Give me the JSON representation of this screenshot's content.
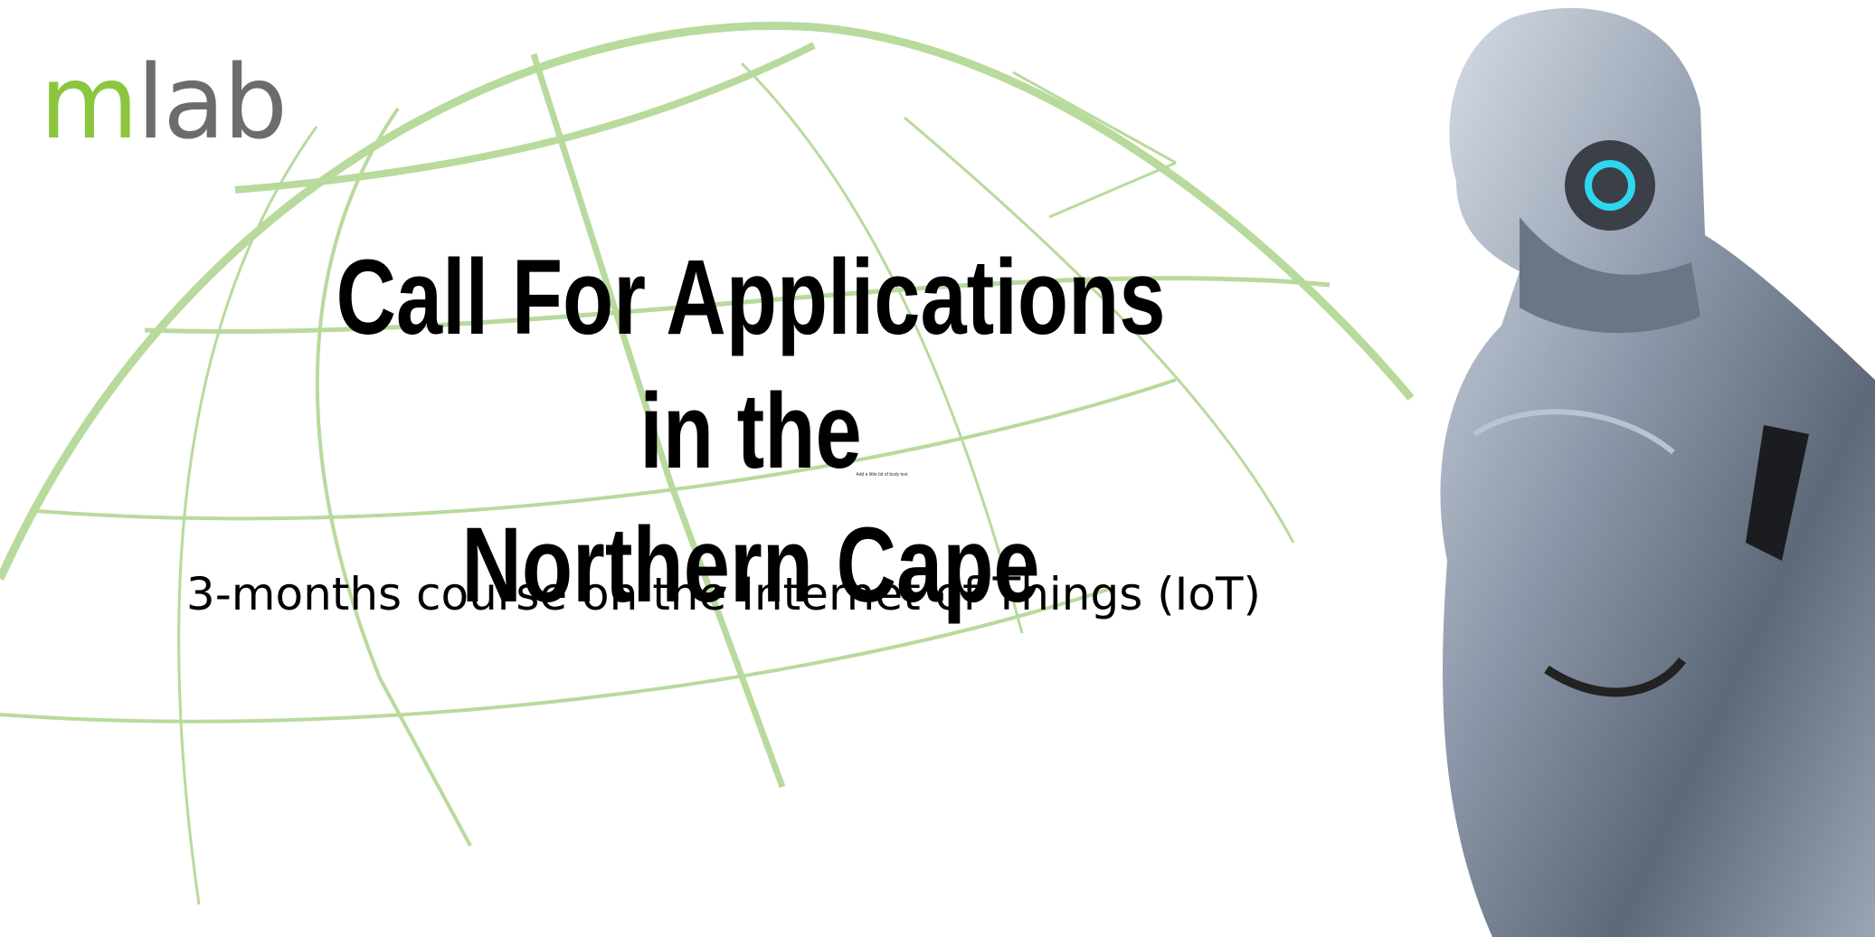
{
  "logo": {
    "text_m": "m",
    "text_lab": "lab",
    "color_m": "#8cc63f",
    "color_lab": "#6b6d6c"
  },
  "title_line1": "Call For Applications in the",
  "title_line2": "Northern Cape",
  "body_placeholder": "Add a little bit of body text",
  "subtitle": "3-months course on the Internet of Things (IoT)",
  "globe_color": "#b5d99a"
}
